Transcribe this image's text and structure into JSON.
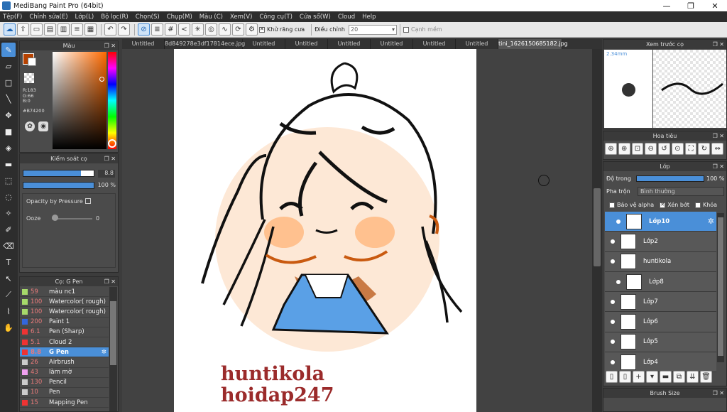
{
  "window": {
    "title": "MediBang Paint Pro (64bit)",
    "minimize": "—",
    "maximize": "❐",
    "close": "✕"
  },
  "menu": [
    "Tệp(F)",
    "Chỉnh sửa(E)",
    "Lớp(L)",
    "Bộ lọc(R)",
    "Chọn(S)",
    "Chụp(M)",
    "Màu (C)",
    "Xem(V)",
    "Công cụ(T)",
    "Cửa sổ(W)",
    "Cloud",
    "Help"
  ],
  "toolbar": {
    "antialias_label": "Khử răng cưa",
    "correction_label": "Điều chỉnh",
    "correction_value": "20",
    "edge_label": "Cạnh mềm"
  },
  "tabs": [
    "Untitled",
    "8d849278e3df17814ece.jpg",
    "Untitled",
    "Untitled",
    "Untitled",
    "Untitled",
    "Untitled",
    "Untitled",
    "tini_1626150685182.jpg"
  ],
  "color_panel": {
    "title": "Màu",
    "r": "R:183",
    "g": "G:66",
    "b": "B:0",
    "hex": "#B74200",
    "main_color": "#B74200"
  },
  "brush_control": {
    "title": "Kiểm soát cọ",
    "size_value": "8.8",
    "opacity_value": "100 %",
    "opacity_pressure_label": "Opacity by Pressure",
    "ooze_label": "Ooze",
    "ooze_value": "0",
    "size_fill": 0.82,
    "opacity_fill": 1.0
  },
  "brush_list": {
    "title": "Cọ: G Pen",
    "items": [
      {
        "size": "59",
        "name": "màu nc1",
        "color": "#a6d96a"
      },
      {
        "size": "100",
        "name": "Watercolor( rough)",
        "color": "#a6d96a"
      },
      {
        "size": "100",
        "name": "Watercolor( rough)",
        "color": "#a6d96a"
      },
      {
        "size": "200",
        "name": "Paint 1",
        "color": "#3366dd"
      },
      {
        "size": "6.1",
        "name": "Pen (Sharp)",
        "color": "#ee3333"
      },
      {
        "size": "5.1",
        "name": "Cloud 2",
        "color": "#ee3333"
      },
      {
        "size": "8.8",
        "name": "G Pen",
        "color": "#ee3333"
      },
      {
        "size": "26",
        "name": "Airbrush",
        "color": "#cccccc"
      },
      {
        "size": "43",
        "name": "làm mờ",
        "color": "#f0a0f0"
      },
      {
        "size": "130",
        "name": "Pencil",
        "color": "#cccccc"
      },
      {
        "size": "10",
        "name": "Pen",
        "color": "#cccccc"
      },
      {
        "size": "15",
        "name": "Mapping Pen",
        "color": "#ee3333"
      }
    ]
  },
  "preview": {
    "title": "Xem trước cọ",
    "size": "2.34mm"
  },
  "navigator": {
    "title": "Hoa tiêu"
  },
  "layers": {
    "title": "Lớp",
    "opacity_label": "Độ trong",
    "opacity_value": "100 %",
    "blend_label": "Pha trộn",
    "blend_value": "Bình thường",
    "protect_alpha": "Bảo vệ alpha",
    "clipping": "Xén bớt",
    "lock": "Khóa",
    "items": [
      "Lớp10",
      "Lớp2",
      "huntikola",
      "Lớp8",
      "Lớp7",
      "Lớp6",
      "Lớp5",
      "Lớp4"
    ]
  },
  "brush_size_panel": {
    "title": "Brush Size"
  },
  "canvas_text": {
    "line1": "huntikola",
    "line2": "hoidap247"
  }
}
